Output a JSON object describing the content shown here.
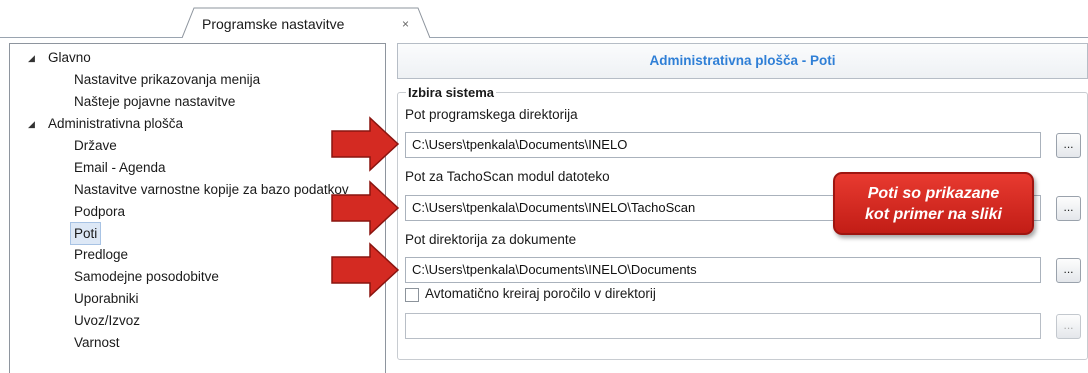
{
  "tab": {
    "title": "Programske nastavitve",
    "close_glyph": "×"
  },
  "tree": [
    {
      "label": "Glavno",
      "toggle": "◢"
    },
    {
      "label": "Nastavitve prikazovanja menija"
    },
    {
      "label": "Našteje pojavne nastavitve"
    },
    {
      "label": "Administrativna plošča",
      "toggle": "◢"
    },
    {
      "label": "Države"
    },
    {
      "label": "Email - Agenda"
    },
    {
      "label": "Nastavitve varnostne kopije za bazo podatkov"
    },
    {
      "label": "Podpora"
    },
    {
      "label": "Poti",
      "selected": true
    },
    {
      "label": "Predloge"
    },
    {
      "label": "Samodejne posodobitve"
    },
    {
      "label": "Uporabniki"
    },
    {
      "label": "Uvoz/Izvoz"
    },
    {
      "label": "Varnost"
    }
  ],
  "panel": {
    "header": "Administrativna plošča - Poti",
    "group_title": "Izbira sistema",
    "fields": [
      {
        "label": "Pot programskega direktorija",
        "value": "C:\\Users\\tpenkala\\Documents\\INELO",
        "button": "..."
      },
      {
        "label": "Pot za TachoScan modul datoteko",
        "value": "C:\\Users\\tpenkala\\Documents\\INELO\\TachoScan",
        "button": "..."
      },
      {
        "label": "Pot direktorija za dokumente",
        "value": "C:\\Users\\tpenkala\\Documents\\INELO\\Documents",
        "button": "..."
      }
    ],
    "checkbox_label": "Avtomatično kreiraj poročilo v direktorij",
    "report_path": {
      "value": "",
      "button": "..."
    }
  },
  "callout": {
    "line1": "Poti so prikazane",
    "line2": "kot primer na sliki"
  },
  "colors": {
    "header_text": "#2f7fd6",
    "arrow": "#d42a22",
    "callout": "#d42a22"
  }
}
